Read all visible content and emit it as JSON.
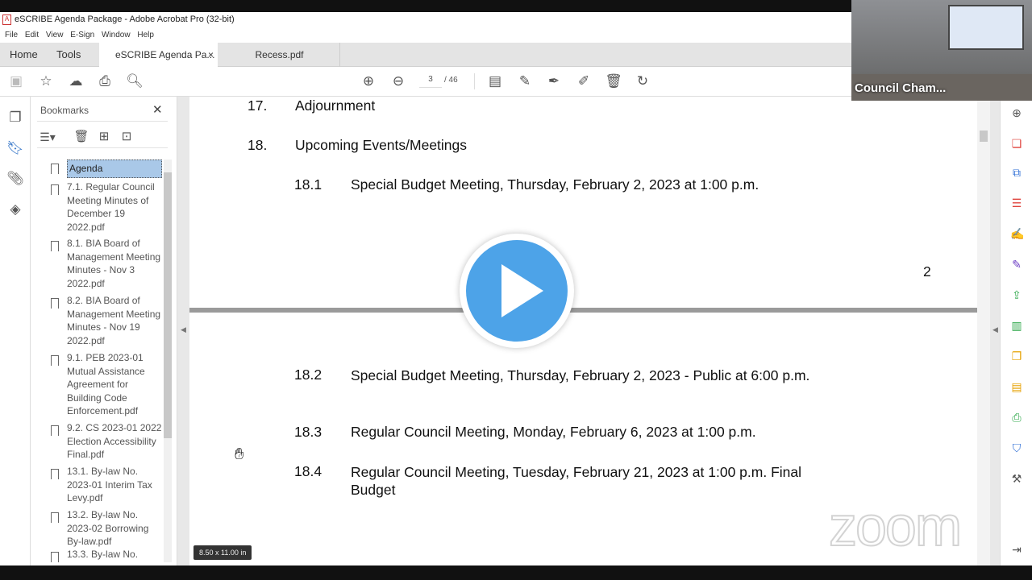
{
  "window": {
    "title": "eSCRIBE Agenda Package - Adobe Acrobat Pro (32-bit)"
  },
  "menu": [
    "File",
    "Edit",
    "View",
    "E-Sign",
    "Window",
    "Help"
  ],
  "tabs": {
    "home": "Home",
    "tools": "Tools",
    "active": "eSCRIBE Agenda Pa...",
    "close": "×",
    "second": "Recess.pdf"
  },
  "toolbar": {
    "page_current": "3",
    "page_total": "/ 46"
  },
  "bookmarks": {
    "title": "Bookmarks",
    "close": "✕",
    "items": [
      "Agenda",
      "7.1. Regular Council Meeting Minutes of December 19 2022.pdf",
      "8.1. BIA Board of Management Meeting Minutes - Nov 3 2022.pdf",
      "8.2. BIA Board of Management Meeting Minutes - Nov 19 2022.pdf",
      "9.1. PEB 2023-01 Mutual Assistance Agreement for Building Code Enforcement.pdf",
      "9.2. CS 2023-01 2022 Election Accessibility Final.pdf",
      "13.1. By-law No. 2023-01 Interim Tax Levy.pdf",
      "13.2. By-law No. 2023-02 Borrowing By-law.pdf",
      "13.3. By-law No."
    ]
  },
  "document": {
    "s17_num": "17.",
    "s17": "Adjournment",
    "s18_num": "18.",
    "s18": "Upcoming Events/Meetings",
    "i181_num": "18.1",
    "i181": "Special Budget Meeting, Thursday, February 2, 2023 at 1:00 p.m.",
    "page_number": "2",
    "i182_num": "18.2",
    "i182": "Special Budget Meeting, Thursday, February 2, 2023 - Public at 6:00 p.m.",
    "i183_num": "18.3",
    "i183": "Regular Council Meeting, Monday, February 6, 2023 at 1:00 p.m.",
    "i184_num": "18.4",
    "i184": "Regular Council Meeting, Tuesday, February 21, 2023 at 1:00 p.m. Final Budget"
  },
  "status": {
    "page_size": "8.50 x 11.00 in"
  },
  "video": {
    "label": "Council Cham...",
    "watermark": "zoom"
  },
  "colors": {
    "play": "#4da3e8",
    "selection": "#a9c8e8"
  }
}
